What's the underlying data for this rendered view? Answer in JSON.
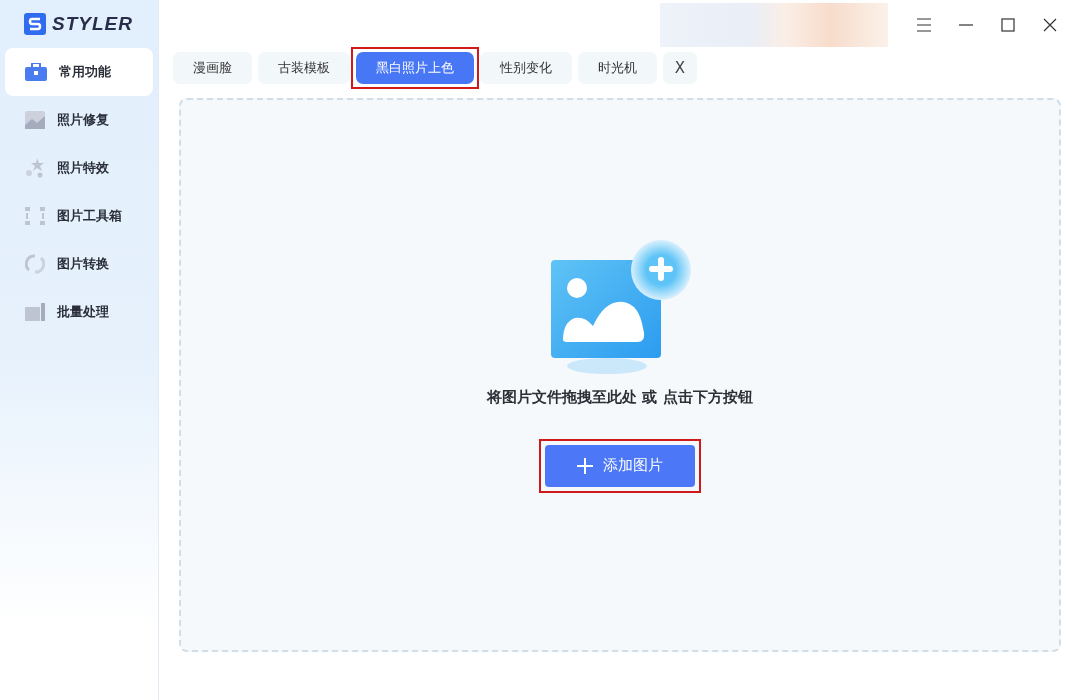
{
  "app": {
    "logo_text": "STYLER"
  },
  "sidebar": {
    "items": [
      {
        "label": "常用功能",
        "selected": true
      },
      {
        "label": "照片修复",
        "selected": false
      },
      {
        "label": "照片特效",
        "selected": false
      },
      {
        "label": "图片工具箱",
        "selected": false
      },
      {
        "label": "图片转换",
        "selected": false
      },
      {
        "label": "批量处理",
        "selected": false
      }
    ]
  },
  "tabs": [
    {
      "label": "漫画脸",
      "selected": false,
      "highlighted": false
    },
    {
      "label": "古装模板",
      "selected": false,
      "highlighted": false
    },
    {
      "label": "黑白照片上色",
      "selected": true,
      "highlighted": true
    },
    {
      "label": "性别变化",
      "selected": false,
      "highlighted": false
    },
    {
      "label": "时光机",
      "selected": false,
      "highlighted": false
    }
  ],
  "close_tab": "X",
  "drop_zone": {
    "hint": "将图片文件拖拽至此处 或 点击下方按钮",
    "button": {
      "label": "添加图片",
      "highlighted": true
    }
  }
}
